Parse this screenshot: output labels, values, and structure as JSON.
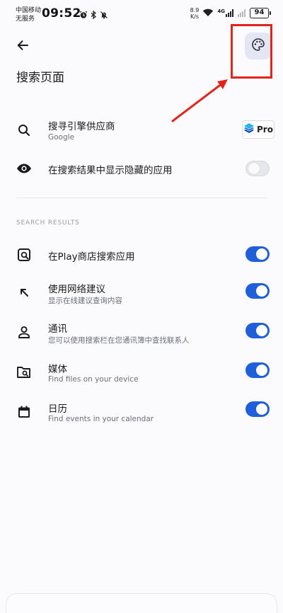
{
  "status_bar": {
    "carrier_line1": "中国移动",
    "carrier_line2": "无服务",
    "time": "09:52",
    "net_speed_value": "8.9",
    "net_speed_unit": "K/s",
    "signal_label": "4G",
    "battery": "94"
  },
  "header": {
    "title": "搜索页面"
  },
  "settings": {
    "search_engine": {
      "title": "搜寻引擎供应商",
      "subtitle": "Google",
      "badge": "Pro"
    },
    "show_hidden": {
      "title": "在搜索结果中显示隐藏的应用",
      "enabled": false
    }
  },
  "section": {
    "label": "SEARCH RESULTS"
  },
  "results": [
    {
      "title": "在Play商店搜索应用",
      "subtitle": "",
      "icon": "play-store-search-icon",
      "enabled": true
    },
    {
      "title": "使用网络建议",
      "subtitle": "显示在线建议查询内容",
      "icon": "arrow-up-left-icon",
      "enabled": true
    },
    {
      "title": "通讯",
      "subtitle": "您可以使用搜索栏在您通讯簿中查找联系人",
      "icon": "person-icon",
      "enabled": true
    },
    {
      "title": "媒体",
      "subtitle": "Find files on your device",
      "icon": "folder-search-icon",
      "enabled": true
    },
    {
      "title": "日历",
      "subtitle": "Find events in your calendar",
      "icon": "calendar-icon",
      "enabled": true
    }
  ],
  "colors": {
    "accent": "#1f5fd9",
    "highlight": "#e0241b",
    "palette_bg": "#e4e7f3"
  }
}
